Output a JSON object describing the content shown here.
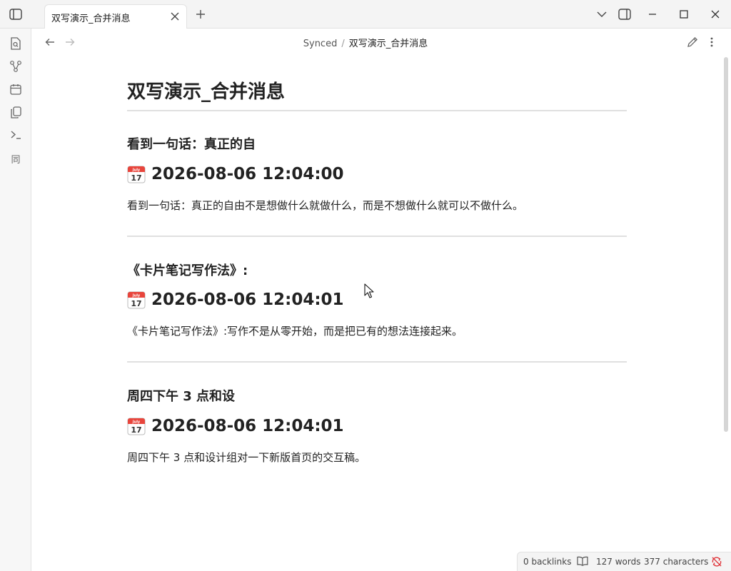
{
  "tab": {
    "title": "双写演示_合并消息"
  },
  "breadcrumb": {
    "folder": "Synced",
    "separator": "/",
    "current": "双写演示_合并消息"
  },
  "note": {
    "title": "双写演示_合并消息",
    "entries": [
      {
        "heading": "看到一句话：真正的自",
        "timestamp": "2026-08-06 12:04:00",
        "body": "看到一句话：真正的自由不是想做什么就做什么，而是不想做什么就可以不做什么。"
      },
      {
        "heading": "《卡片笔记写作法》:",
        "timestamp": "2026-08-06 12:04:01",
        "body": "《卡片笔记写作法》:写作不是从零开始，而是把已有的想法连接起来。"
      },
      {
        "heading": "周四下午 3 点和设",
        "timestamp": "2026-08-06 12:04:01",
        "body": "周四下午 3 点和设计组对一下新版首页的交互稿。"
      }
    ]
  },
  "calendar_icon": {
    "month": "July",
    "day": "17"
  },
  "ribbon": {
    "sync_label": "同"
  },
  "status": {
    "backlinks": "0 backlinks",
    "words": "127 words",
    "characters": "377 characters"
  },
  "colors": {
    "sync_error": "#e0393e",
    "calendar_red": "#e8453c"
  },
  "icons": [
    "sidebar-toggle-icon",
    "close-icon",
    "plus-icon",
    "chevron-down-icon",
    "panel-right-icon",
    "minimize-icon",
    "maximize-icon",
    "window-close-icon",
    "file-search-icon",
    "graph-icon",
    "calendar-icon",
    "copy-icon",
    "terminal-icon",
    "arrow-left-icon",
    "arrow-right-icon",
    "edit-icon",
    "more-icon",
    "book-icon",
    "sync-error-icon"
  ]
}
